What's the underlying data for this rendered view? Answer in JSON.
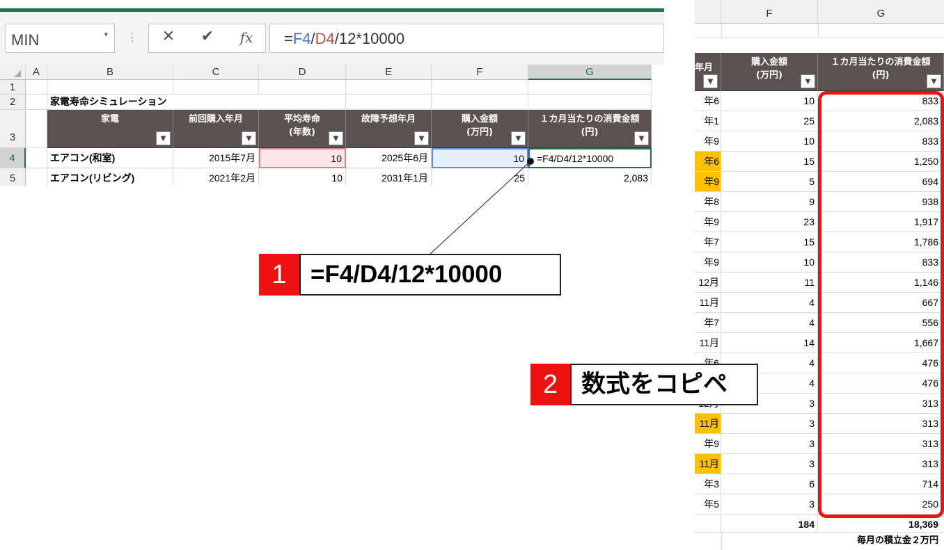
{
  "excel": {
    "name_box": "MIN",
    "formula_bar": {
      "prefix": "=",
      "ref1": "F4",
      "sep1": "/",
      "ref2": "D4",
      "rest": "/12*10000"
    },
    "column_headers": [
      "A",
      "B",
      "C",
      "D",
      "E",
      "F",
      "G"
    ],
    "row_headers": [
      "1",
      "2",
      "3",
      "4",
      "5"
    ],
    "title": "家電寿命シミュレーション",
    "table_headers": {
      "b": "家電",
      "c": "前回購入年月",
      "d_line1": "平均寿命",
      "d_line2": "(年数)",
      "e": "故障予想年月",
      "f_line1": "購入金額",
      "f_line2": "(万円)",
      "g_line1": "１カ月当たりの消費金額",
      "g_line2": "(円)"
    },
    "rows": [
      {
        "b": "エアコン(和室)",
        "c": "2015年7月",
        "d": "10",
        "e": "2025年6月",
        "f": "10",
        "g": "=F4/D4/12*10000"
      },
      {
        "b": "エアコン(リビング)",
        "c": "2021年2月",
        "d": "10",
        "e": "2031年1月",
        "f": "25",
        "g": "2,083"
      }
    ]
  },
  "callouts": [
    {
      "number": "1",
      "text": "=F4/D4/12*10000"
    },
    {
      "number": "2",
      "text": "数式をコピペ"
    }
  ],
  "right_panel": {
    "col_f": "F",
    "col_g": "G",
    "header_e_partial": "年月",
    "header_f_line1": "購入金額",
    "header_f_line2": "(万円)",
    "header_g_line1": "１カ月当たりの消費金額",
    "header_g_line2": "(円)",
    "rows": [
      {
        "e": "年6月",
        "f": "10",
        "g": "833",
        "hl": false
      },
      {
        "e": "年1月",
        "f": "25",
        "g": "2,083",
        "hl": false
      },
      {
        "e": "年9月",
        "f": "10",
        "g": "833",
        "hl": false
      },
      {
        "e": "年6月",
        "f": "15",
        "g": "1,250",
        "hl": true
      },
      {
        "e": "年9月",
        "f": "5",
        "g": "694",
        "hl": true
      },
      {
        "e": "年8月",
        "f": "9",
        "g": "938",
        "hl": false
      },
      {
        "e": "年9月",
        "f": "23",
        "g": "1,917",
        "hl": false
      },
      {
        "e": "年7月",
        "f": "15",
        "g": "1,786",
        "hl": false
      },
      {
        "e": "年9月",
        "f": "10",
        "g": "833",
        "hl": false
      },
      {
        "e": "12月",
        "f": "11",
        "g": "1,146",
        "hl": false
      },
      {
        "e": "11月",
        "f": "4",
        "g": "667",
        "hl": false
      },
      {
        "e": "年7月",
        "f": "4",
        "g": "556",
        "hl": false
      },
      {
        "e": "11月",
        "f": "14",
        "g": "1,667",
        "hl": false
      },
      {
        "e": "年6月",
        "f": "4",
        "g": "476",
        "hl": false
      },
      {
        "e": "",
        "f": "4",
        "g": "476",
        "hl": false
      },
      {
        "e": "12月",
        "f": "3",
        "g": "313",
        "hl": false
      },
      {
        "e": "11月",
        "f": "3",
        "g": "313",
        "hl": true
      },
      {
        "e": "年9月",
        "f": "3",
        "g": "313",
        "hl": false
      },
      {
        "e": "11月",
        "f": "3",
        "g": "313",
        "hl": true
      },
      {
        "e": "年3月",
        "f": "6",
        "g": "714",
        "hl": false
      },
      {
        "e": "年5月",
        "f": "3",
        "g": "250",
        "hl": false
      }
    ],
    "total_f": "184",
    "total_g": "18,369",
    "note": "毎月の積立金２万円"
  },
  "colors": {
    "excel_green": "#217346",
    "header_dark": "#5b5150",
    "callout_red": "#ee1111",
    "highlight_orange": "#ffc000",
    "ref_blue": "#4472c4",
    "ref_red": "#c0504d"
  }
}
